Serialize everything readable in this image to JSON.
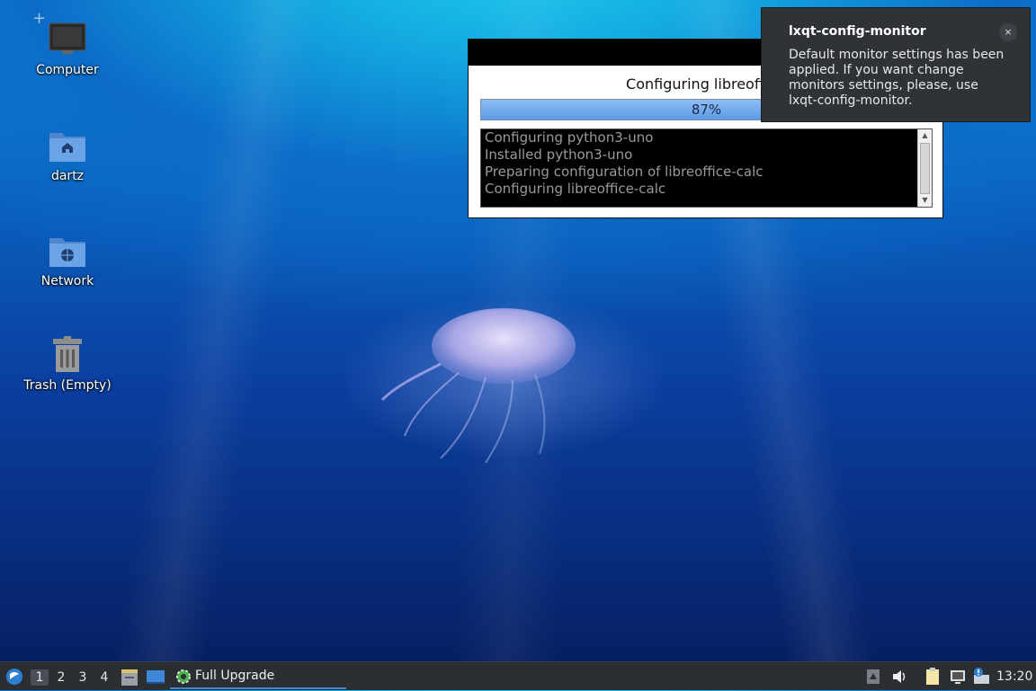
{
  "desktop": {
    "icons": [
      {
        "label": "Computer"
      },
      {
        "label": "dartz"
      },
      {
        "label": "Network"
      },
      {
        "label": "Trash (Empty)"
      }
    ]
  },
  "progress_window": {
    "caption": "Configuring libreoffice",
    "progress_percent": 87,
    "progress_label": "87%",
    "log_lines": [
      "Configuring python3-uno",
      "Installed python3-uno",
      "Preparing configuration of libreoffice-calc",
      "Configuring libreoffice-calc"
    ]
  },
  "notification": {
    "title": "lxqt-config-monitor",
    "body": "Default monitor settings has been applied. If you want change monitors settings, please, use lxqt-config-monitor.",
    "close_label": "×"
  },
  "taskbar": {
    "workspaces": [
      "1",
      "2",
      "3",
      "4"
    ],
    "active_workspace": "1",
    "task_label": "Full Upgrade",
    "clock": "13:20",
    "colors": {
      "accent": "#3d86d6",
      "panel": "#2b2e33"
    }
  }
}
